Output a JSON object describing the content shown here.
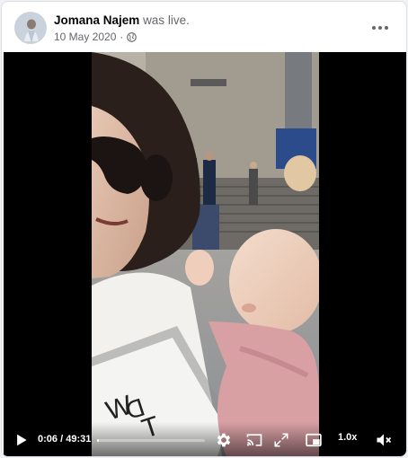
{
  "post": {
    "author": "Jomana Najem",
    "action": "was live.",
    "date": "10 May 2020",
    "separator": "·",
    "privacy_icon": "globe-icon",
    "more_icon": "more-horizontal-icon"
  },
  "video": {
    "current_time": "0:06",
    "duration": "49:31",
    "time_separator": " / ",
    "progress_fraction": 0.002,
    "speed": "1.0x",
    "icons": {
      "play": "play-icon",
      "settings": "gear-icon",
      "cast": "cast-icon",
      "fullscreen": "expand-icon",
      "miniplayer": "miniplayer-icon",
      "volume": "volume-muted-icon"
    }
  },
  "colors": {
    "card_bg": "#ffffff",
    "page_bg": "#f0f2f5",
    "text_primary": "#050505",
    "text_secondary": "#65676b",
    "video_bg": "#000000"
  }
}
